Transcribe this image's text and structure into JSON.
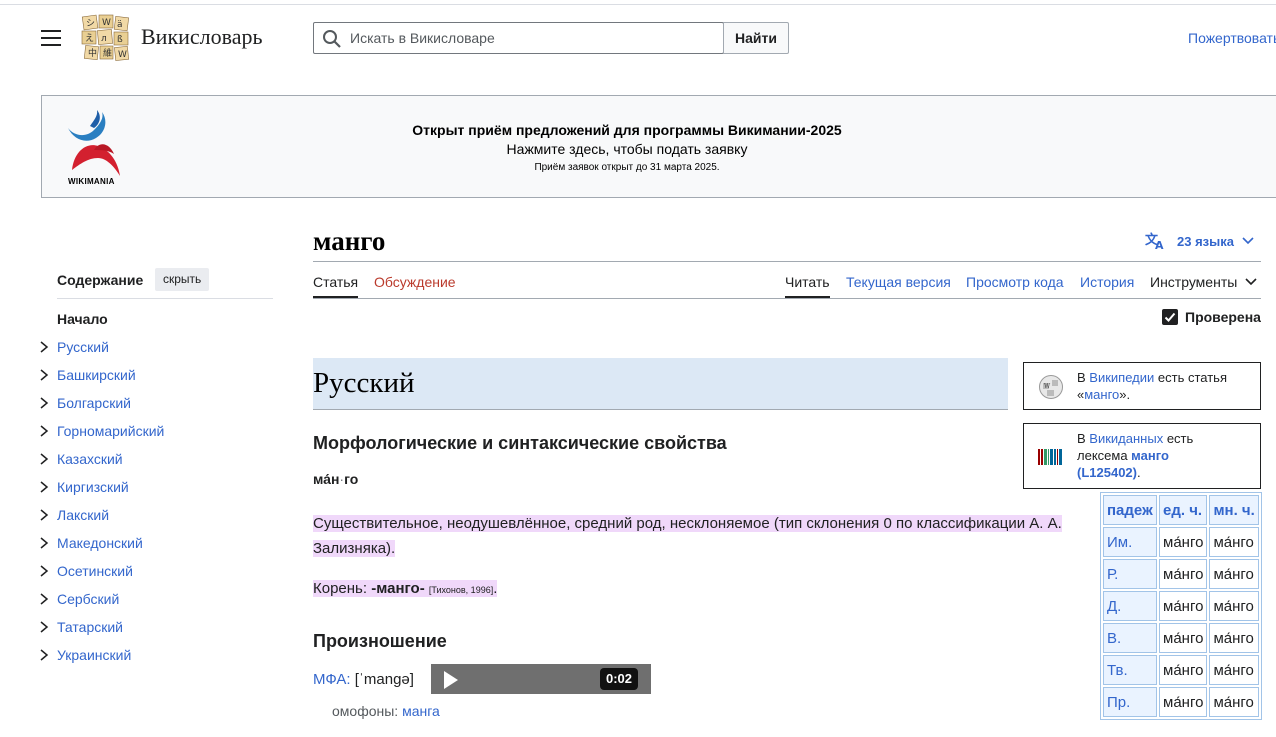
{
  "header": {
    "site_name": "Викисловарь",
    "search_placeholder": "Искать в Викисловаре",
    "search_button": "Найти",
    "donate": "Пожертвовать"
  },
  "banner": {
    "logo_text": "WIKIMANIA",
    "title": "Открыт приём предложений для программы Викимании-2025",
    "subtitle": "Нажмите здесь, чтобы подать заявку",
    "note": "Приём заявок открыт до 31 марта 2025."
  },
  "toc": {
    "title": "Содержание",
    "hide": "скрыть",
    "start": "Начало",
    "items": [
      "Русский",
      "Башкирский",
      "Болгарский",
      "Горномарийский",
      "Казахский",
      "Киргизский",
      "Лакский",
      "Македонский",
      "Осетинский",
      "Сербский",
      "Татарский",
      "Украинский"
    ]
  },
  "page": {
    "title": "манго",
    "languages": "23 языка",
    "tabs": {
      "article": "Статья",
      "talk": "Обсуждение",
      "read": "Читать",
      "current": "Текущая версия",
      "source": "Просмотр кода",
      "history": "История",
      "tools": "Инструменты"
    },
    "checked": "Проверена"
  },
  "content": {
    "lang_heading": "Русский",
    "morph_heading": "Морфологические и синтаксические свойства",
    "syllable_1": "ма́н",
    "syllable_sep": "·",
    "syllable_2": "го",
    "description": "Существительное, неодушевлённое, средний род, несклоняемое (тип склонения 0 по классификации А. А. Зализняка).",
    "root_label": "Корень: ",
    "root_value": "-манго-",
    "root_source": "[Тихонов, 1996]",
    "root_end": ".",
    "pron_heading": "Произношение",
    "mfa_label": "МФА:",
    "mfa_value": " [ˈmangə]",
    "audio_time": "0:02",
    "homophones_label": "омофоны: ",
    "homophones_value": "манга"
  },
  "infobox_wikipedia": {
    "pre": "В ",
    "link": "Википедии",
    "mid": " есть статья «",
    "word": "манго",
    "end": "»."
  },
  "infobox_wikidata": {
    "pre": "В ",
    "link": "Викиданных",
    "mid": " есть лексема ",
    "word": "манго",
    "id": "(L125402)",
    "end": "."
  },
  "declension": {
    "headers": [
      "падеж",
      "ед. ч.",
      "мн. ч."
    ],
    "rows": [
      [
        "Им.",
        "ма́нго",
        "ма́нго"
      ],
      [
        "Р.",
        "ма́нго",
        "ма́нго"
      ],
      [
        "Д.",
        "ма́нго",
        "ма́нго"
      ],
      [
        "В.",
        "ма́нго",
        "ма́нго"
      ],
      [
        "Тв.",
        "ма́нго",
        "ма́нго"
      ],
      [
        "Пр.",
        "ма́нго",
        "ма́нго"
      ]
    ]
  }
}
